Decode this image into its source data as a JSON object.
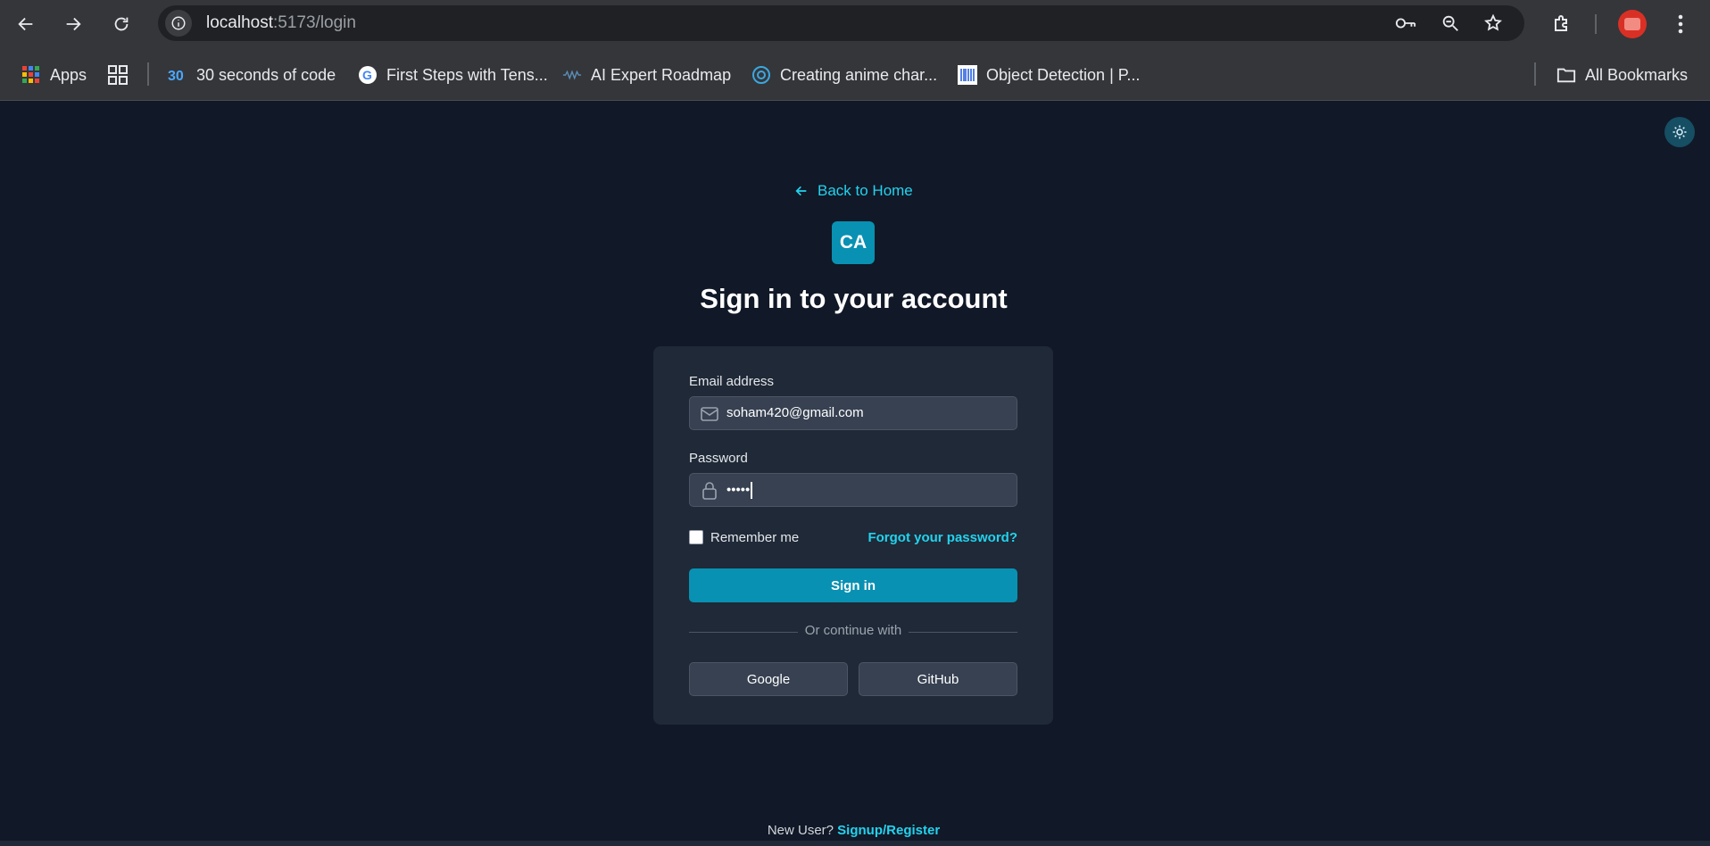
{
  "browser": {
    "url_host": "localhost",
    "url_path": ":5173/login",
    "bookmarks": [
      {
        "label": "Apps",
        "icon": "apps-grid-icon"
      },
      {
        "label": "30 seconds of code",
        "icon": "30s-icon"
      },
      {
        "label": "First Steps with Tens...",
        "icon": "google-icon"
      },
      {
        "label": "AI Expert Roadmap",
        "icon": "ai-roadmap-icon"
      },
      {
        "label": "Creating anime char...",
        "icon": "anime-icon"
      },
      {
        "label": "Object Detection | P...",
        "icon": "barcode-icon"
      }
    ],
    "all_bookmarks_label": "All Bookmarks"
  },
  "page": {
    "back_link": "Back to Home",
    "logo_text": "CA",
    "title": "Sign in to your account",
    "form": {
      "email_label": "Email address",
      "email_value": "soham420@gmail.com",
      "password_label": "Password",
      "password_value": "•••••",
      "remember_label": "Remember me",
      "forgot_label": "Forgot your password?",
      "signin_label": "Sign in",
      "divider_text": "Or continue with",
      "google_label": "Google",
      "github_label": "GitHub"
    },
    "footer": {
      "prompt": "New User?",
      "register_label": "Signup/Register"
    }
  },
  "colors": {
    "accent": "#0891b2",
    "link": "#22d3ee",
    "background": "#111827",
    "card": "#1f2937"
  }
}
